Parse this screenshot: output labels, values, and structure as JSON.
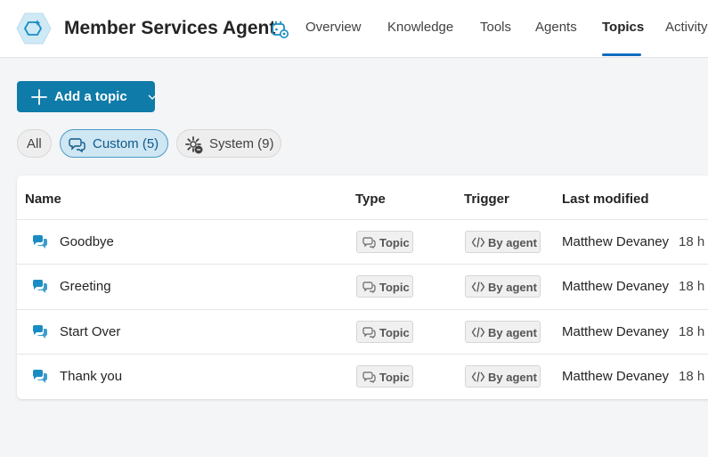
{
  "header": {
    "agent_name": "Member Services Agent",
    "logo_icon": "agent-hexagon-icon",
    "settings_icon": "agent-settings-icon",
    "tabs": [
      {
        "label": "Overview",
        "active": false
      },
      {
        "label": "Knowledge",
        "active": false
      },
      {
        "label": "Tools",
        "active": false
      },
      {
        "label": "Agents",
        "active": false
      },
      {
        "label": "Topics",
        "active": true
      },
      {
        "label": "Activity",
        "active": false
      }
    ]
  },
  "toolbar": {
    "add_topic_label": "Add a topic",
    "add_topic_icon": "plus-icon",
    "accent_color": "#0f7ba8"
  },
  "filters": {
    "all_label": "All",
    "custom_label": "Custom (5)",
    "system_label": "System (9)",
    "active": "Custom"
  },
  "table": {
    "columns": {
      "name": "Name",
      "type": "Type",
      "trigger": "Trigger",
      "modified": "Last modified"
    },
    "rows": [
      {
        "name": "Goodbye",
        "type": "Topic",
        "trigger": "By agent",
        "modified_by": "Matthew Devaney",
        "time": "18 h"
      },
      {
        "name": "Greeting",
        "type": "Topic",
        "trigger": "By agent",
        "modified_by": "Matthew Devaney",
        "time": "18 h"
      },
      {
        "name": "Start Over",
        "type": "Topic",
        "trigger": "By agent",
        "modified_by": "Matthew Devaney",
        "time": "18 h"
      },
      {
        "name": "Thank you",
        "type": "Topic",
        "trigger": "By agent",
        "modified_by": "Matthew Devaney",
        "time": "18 h"
      }
    ]
  }
}
